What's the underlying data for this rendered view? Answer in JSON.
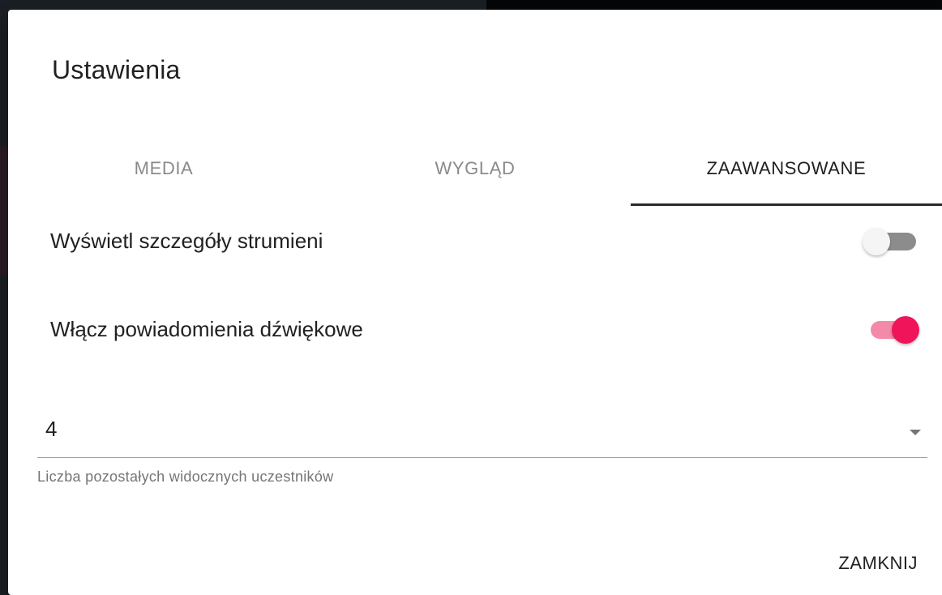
{
  "dialog": {
    "title": "Ustawienia"
  },
  "tabs": [
    {
      "label": "MEDIA",
      "active": false
    },
    {
      "label": "WYGLĄD",
      "active": false
    },
    {
      "label": "ZAAWANSOWANE",
      "active": true
    }
  ],
  "settings": {
    "stream_details": {
      "label": "Wyświetl szczegóły strumieni",
      "enabled": false
    },
    "sound_notifications": {
      "label": "Włącz powiadomienia dźwiękowe",
      "enabled": true
    }
  },
  "participants_select": {
    "value": "4",
    "hint": "Liczba pozostałych widocznych uczestników"
  },
  "footer": {
    "close_label": "ZAMKNIJ"
  },
  "colors": {
    "accent": "#f0145a",
    "accent_track": "#f48aa9"
  }
}
